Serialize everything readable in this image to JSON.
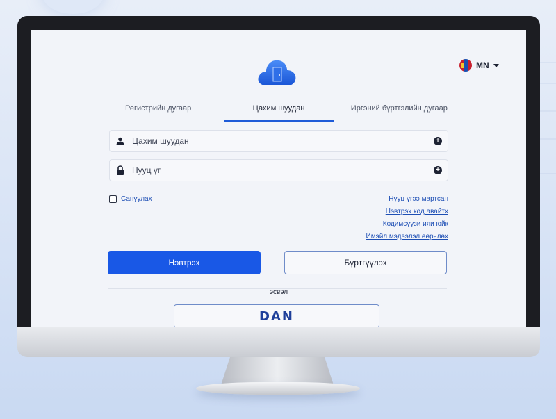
{
  "language": {
    "code": "MN"
  },
  "tabs": [
    {
      "label": "Регистрийн дугаар",
      "active": false
    },
    {
      "label": "Цахим шуудан",
      "active": true
    },
    {
      "label": "Иргэний бүртгэлийн дугаар",
      "active": false
    }
  ],
  "form": {
    "email_placeholder": "Цахим шуудан",
    "password_placeholder": "Нууц үг",
    "remember_label": "Сануулах"
  },
  "links": {
    "forgot_password": "Нууц үгээ мартсан",
    "login_code": "Нэвтрэх код авайтх",
    "resend_code": "Кодимсүүзи ияи юйк",
    "email_verify": "Имэйл мэдээлэл өөрчлөх"
  },
  "buttons": {
    "login": "Нэвтрэх",
    "register": "Бүртгүүлэх",
    "dan": "DAN"
  },
  "separator": {
    "or": "эсвэл"
  },
  "colors": {
    "primary": "#1958e6",
    "link": "#1e4fb5",
    "tab_underline": "#1e5bd8",
    "bezel": "#1c1d22",
    "screen_bg": "#f2f4f9"
  },
  "icons": {
    "logo": "cloud-door-icon",
    "user": "user-icon",
    "lock": "lock-icon",
    "field_action": "plus-circle-icon",
    "language_flag": "mongolia-flag-icon",
    "language_caret": "caret-down-icon"
  }
}
